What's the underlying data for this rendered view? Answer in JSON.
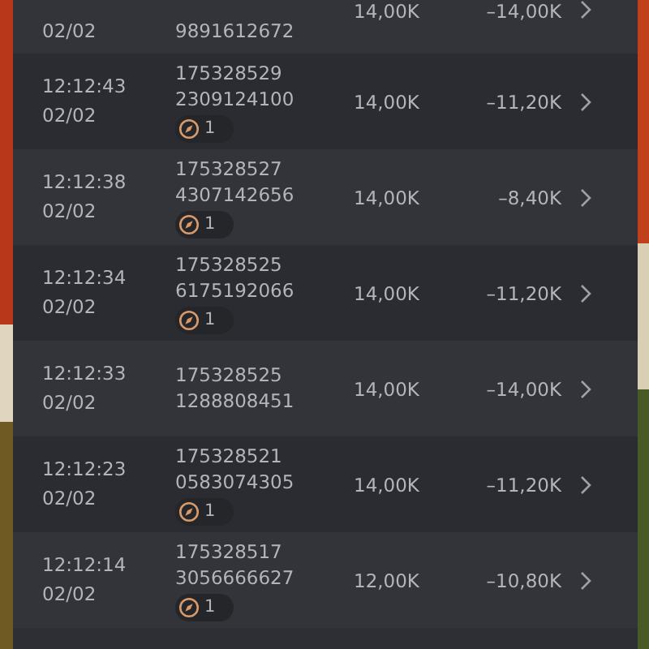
{
  "rows": [
    {
      "kind": "partial",
      "date": "02/02",
      "ids": [
        "9891612672"
      ],
      "amount": "14,00K",
      "change": "–14,00K"
    },
    {
      "kind": "full",
      "time": "12:12:43",
      "date": "02/02",
      "ids": [
        "175328529",
        "2309124100"
      ],
      "badge": "1",
      "amount": "14,00K",
      "change": "–11,20K"
    },
    {
      "kind": "full",
      "time": "12:12:38",
      "date": "02/02",
      "ids": [
        "175328527",
        "4307142656"
      ],
      "badge": "1",
      "amount": "14,00K",
      "change": "–8,40K"
    },
    {
      "kind": "full",
      "time": "12:12:34",
      "date": "02/02",
      "ids": [
        "175328525",
        "6175192066"
      ],
      "badge": "1",
      "amount": "14,00K",
      "change": "–11,20K"
    },
    {
      "kind": "full",
      "time": "12:12:33",
      "date": "02/02",
      "ids": [
        "175328525",
        "1288808451"
      ],
      "amount": "14,00K",
      "change": "–14,00K"
    },
    {
      "kind": "full",
      "time": "12:12:23",
      "date": "02/02",
      "ids": [
        "175328521",
        "0583074305"
      ],
      "badge": "1",
      "amount": "14,00K",
      "change": "–11,20K"
    },
    {
      "kind": "full",
      "time": "12:12:14",
      "date": "02/02",
      "ids": [
        "175328517",
        "3056666627"
      ],
      "badge": "1",
      "amount": "12,00K",
      "change": "–10,80K"
    }
  ]
}
